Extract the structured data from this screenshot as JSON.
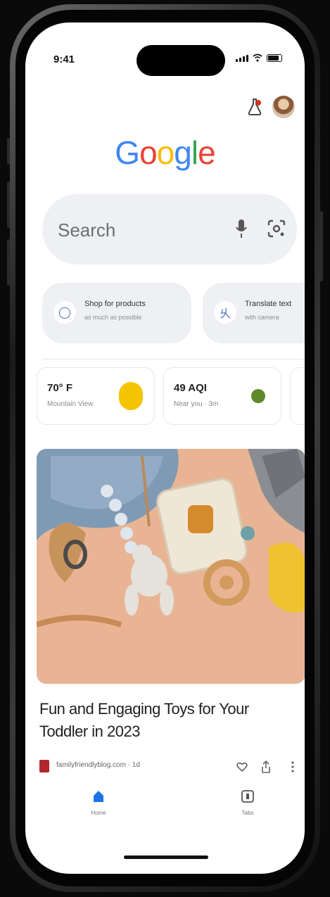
{
  "status_bar": {
    "time": "9:41"
  },
  "logo": {
    "text": "Google"
  },
  "search": {
    "placeholder": "Search"
  },
  "chips": [
    {
      "title": "Shop for products",
      "subtitle": "as much as possible"
    },
    {
      "title": "Translate text",
      "subtitle": "with camera"
    }
  ],
  "info_cards": [
    {
      "value": "70° F",
      "label": "Mountain View"
    },
    {
      "value": "49 AQI",
      "label": "Near you · 3m"
    }
  ],
  "feed": {
    "title": "Fun and Engaging Toys for Your Toddler in 2023",
    "source": "familyfriendlyblog.com · 1d"
  },
  "bottom_nav": [
    {
      "label": "Home",
      "active": true
    },
    {
      "label": "Tabs",
      "active": false
    }
  ],
  "colors": {
    "google_blue": "#4285F4",
    "google_red": "#EA4335",
    "google_yellow": "#FBBC05",
    "google_green": "#34A853",
    "weather_sun": "#F5C400",
    "aqi_good": "#5F8A2A"
  }
}
